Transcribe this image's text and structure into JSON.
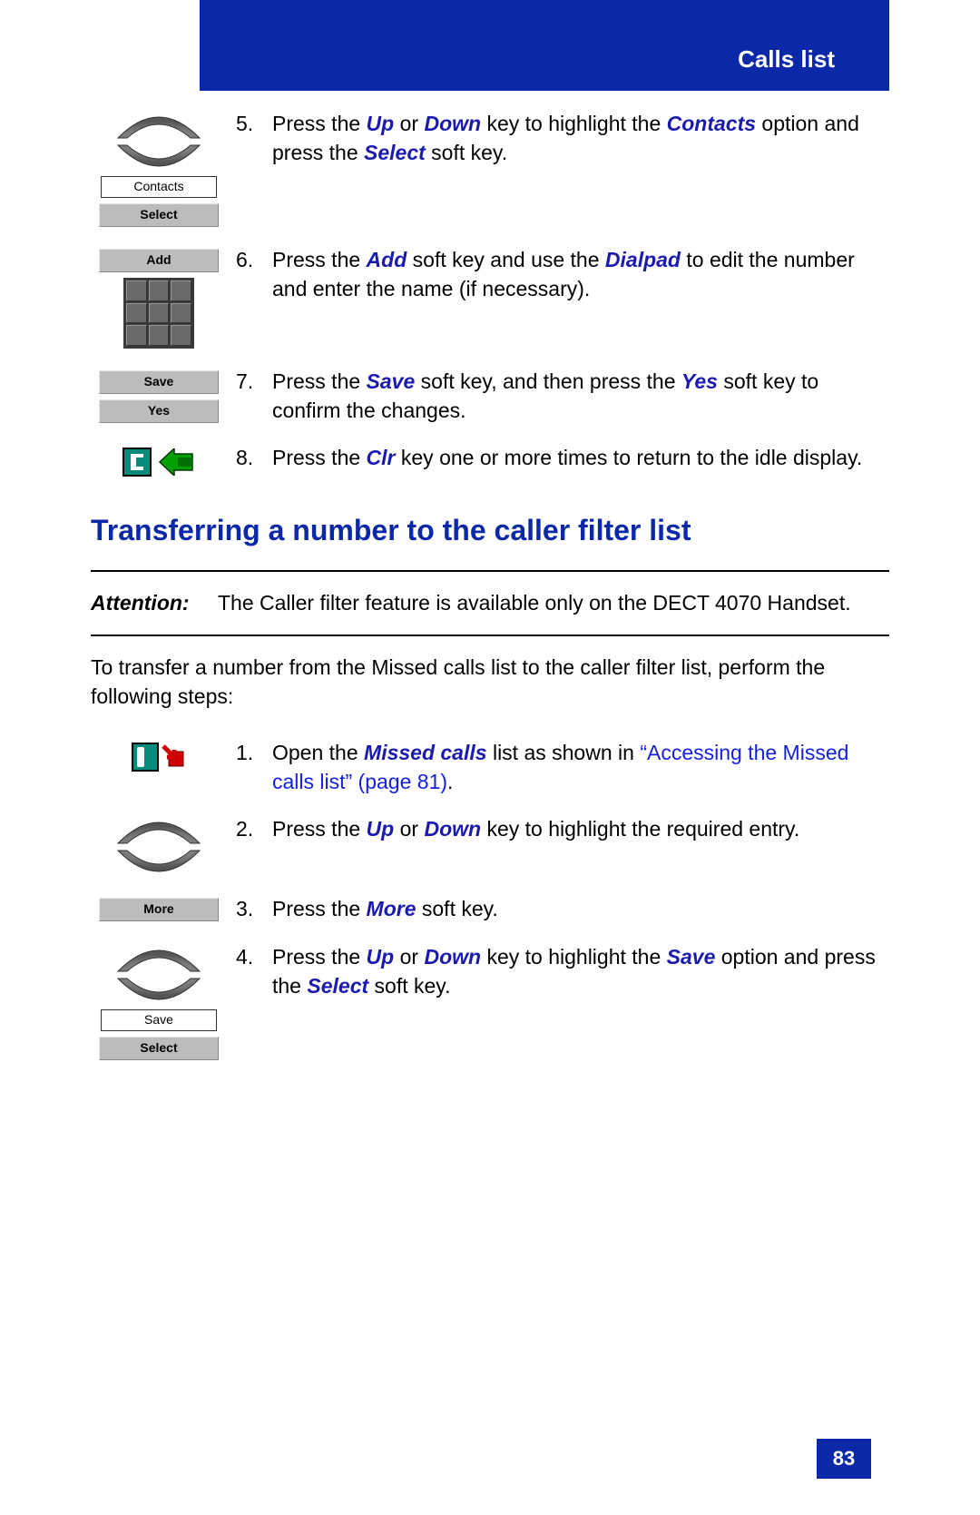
{
  "header": {
    "title": "Calls list"
  },
  "page_number": "83",
  "section1": {
    "step5": {
      "num": "5.",
      "t1": "Press the ",
      "k1": "Up",
      "t2": " or ",
      "k2": "Down",
      "t3": " key to highlight the ",
      "opt": "Contacts",
      "t4": " option and press the ",
      "soft": "Select",
      "t5": " soft key.",
      "lcd": "Contacts",
      "btn": "Select"
    },
    "step6": {
      "num": "6.",
      "t1": "Press the ",
      "k1": "Add",
      "t2": " soft key and use the ",
      "k2": "Dialpad",
      "t3": " to edit the number and enter the name (if necessary).",
      "btn": "Add"
    },
    "step7": {
      "num": "7.",
      "t1": "Press the ",
      "k1": "Save",
      "t2": " soft key, and then press the ",
      "k2": "Yes",
      "t3": " soft key to confirm the changes.",
      "btn1": "Save",
      "btn2": "Yes"
    },
    "step8": {
      "num": "8.",
      "t1": "Press the ",
      "k1": "Clr",
      "t2": " key one or more times to return to the idle display."
    }
  },
  "heading": "Transferring a number to the caller filter list",
  "attention": {
    "label": "Attention:",
    "text": "The Caller filter feature is available only on the DECT 4070 Handset."
  },
  "intro": "To transfer a number from the Missed calls list to the caller filter list, perform the following steps:",
  "section2": {
    "step1": {
      "num": "1.",
      "t1": "Open the ",
      "k1": "Missed calls",
      "t2": " list as shown in ",
      "link": "“Accessing the Missed calls list” (page 81)",
      "t3": "."
    },
    "step2": {
      "num": "2.",
      "t1": "Press the ",
      "k1": "Up",
      "t2": " or ",
      "k2": "Down",
      "t3": " key to highlight the required entry."
    },
    "step3": {
      "num": "3.",
      "t1": "Press the ",
      "k1": "More",
      "t2": " soft key.",
      "btn": "More"
    },
    "step4": {
      "num": "4.",
      "t1": "Press the ",
      "k1": "Up",
      "t2": " or ",
      "k2": "Down",
      "t3": " key to highlight the ",
      "opt": "Save",
      "t4": " option and press the ",
      "soft": "Select",
      "t5": " soft key.",
      "lcd": "Save",
      "btn": "Select"
    }
  }
}
